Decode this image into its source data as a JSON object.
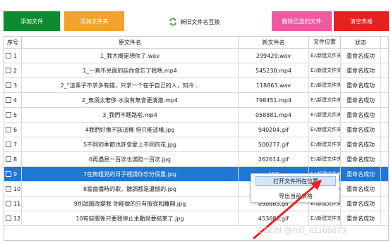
{
  "toolbar": {
    "add_file": "添加文件",
    "add_folder": "添加文件夹",
    "swap": "新旧文件名互换",
    "delete_selected": "删除已选的文件",
    "clear_table": "清空表格"
  },
  "colors": {
    "add_file": "#0d8b2f",
    "add_folder": "#f2a22c",
    "delete_selected": "#ee5aa0",
    "clear_table": "#e8201e",
    "selected_row": "#1f78d4",
    "arrow": "#e8201e"
  },
  "table": {
    "headers": [
      "序号",
      "原文件名",
      "新文件名",
      "文件位置",
      "状态"
    ],
    "rows": [
      {
        "no": "1",
        "orig": "1_我大概是想你了.wav",
        "new": "299429.wav",
        "loc": "E:\\新建文件夹\\",
        "status": "重命名成功"
      },
      {
        "no": "2",
        "orig": "1_一直不見面的話你會忘了我嗎.mp4",
        "new": "545230.mp4",
        "loc": "E:\\新建文件夹\\",
        "status": "重命名成功"
      },
      {
        "no": "3",
        "orig": "2_“這輩子不求多有錢，只求一个在乎自己的人，知冷...",
        "new": "118863.wav",
        "loc": "E:\\新建文件夹\\",
        "status": "重命名成功"
      },
      {
        "no": "4",
        "orig": "2_無須太奢侈 水沒有無會更清澈.mp4",
        "new": "798451.mp4",
        "loc": "E:\\新建文件夹\\",
        "status": "重命名成功"
      },
      {
        "no": "5",
        "orig": "3_我們不睏路啦.mp4",
        "new": "058881.mp4",
        "loc": "E:\\新建文件夹\\",
        "status": "重命名成功"
      },
      {
        "no": "6",
        "orig": "4我們好像不該這樣 但只能這樣.jpg",
        "new": "940204.gif",
        "loc": "E:\\新建文件夹\\",
        "status": "重命名成功"
      },
      {
        "no": "7",
        "orig": "5不同的季節也許會愛上不同的花.jpg",
        "new": "500277.gif",
        "loc": "E:\\新建文件夹\\",
        "status": "重命名成功"
      },
      {
        "no": "8",
        "orig": "6再遇見一百次也滿陷一百次.jpg",
        "new": "262614.gif",
        "loc": "E:\\新建文件夹\\",
        "status": "重命名成功"
      },
      {
        "no": "9",
        "orig": "7在無粗見的日子裡請你忘分保重.jpg",
        "new": "687",
        "loc": "E:\\新建文件夹\\",
        "status": "重命名成功"
      },
      {
        "no": "10",
        "orig": "8當曲播時的歌，聽調都是遺憾的.jpg",
        "new": "829",
        "loc": "E:\\新建文件夹\\",
        "status": "重命名成功"
      },
      {
        "no": "11",
        "orig": "9別試圖改變我 你能做的只有服從和離開.jpg",
        "new": "090885.gif",
        "loc": "E:\\新建文件夹\\",
        "status": "重命名成功"
      },
      {
        "no": "12",
        "orig": "10有些關係只要我停止主動就要結束了.jpg",
        "new": "453688.gif",
        "loc": "E:\\新建文件夹\\",
        "status": "重命名成功"
      }
    ]
  },
  "context_menu": {
    "open_location": "打开文件所在位置",
    "export_table": "导出当前表格"
  },
  "watermark": "CSDN @m0_61166673"
}
